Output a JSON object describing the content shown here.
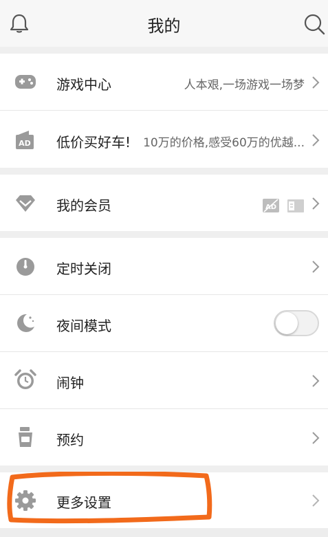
{
  "header": {
    "title": "我的",
    "bell_icon": "bell-icon",
    "search_icon": "search-icon"
  },
  "rows": {
    "game_center": {
      "label": "游戏中心",
      "sub": "人本艰,一场游戏一场梦",
      "icon": "gamepad-icon"
    },
    "cheap_car": {
      "label": "低价买好车!",
      "sub": "10万的价格,感受60万的优越...",
      "icon": "ad-icon"
    },
    "membership": {
      "label": "我的会员",
      "icon": "diamond-icon"
    },
    "timer_off": {
      "label": "定时关闭",
      "icon": "timer-icon"
    },
    "night_mode": {
      "label": "夜间模式",
      "icon": "moon-icon",
      "toggle_on": false
    },
    "alarm": {
      "label": "闹钟",
      "icon": "alarm-clock-icon"
    },
    "reservation": {
      "label": "预约",
      "icon": "cup-icon"
    },
    "more_settings": {
      "label": "更多设置",
      "icon": "gear-icon"
    }
  },
  "colors": {
    "annotation": "#f26a1b",
    "icon_gray": "#9a9a9a",
    "background": "#efefef"
  }
}
